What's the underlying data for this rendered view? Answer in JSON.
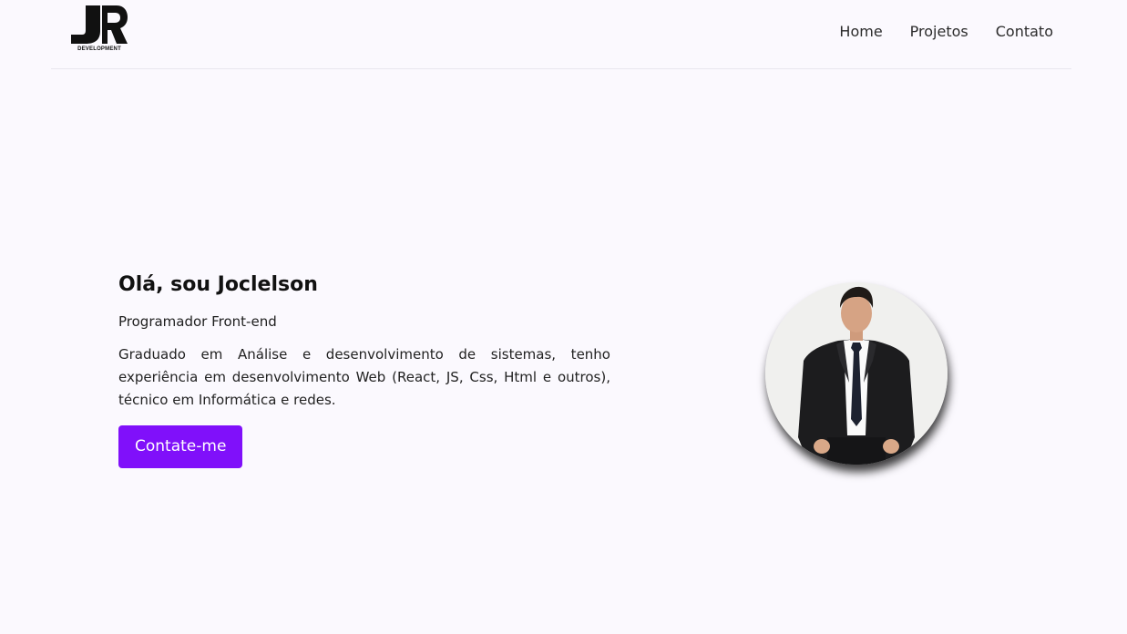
{
  "header": {
    "logo": {
      "mark": "JR",
      "caption": "DEVELOPMENT"
    },
    "nav": [
      {
        "label": "Home"
      },
      {
        "label": "Projetos"
      },
      {
        "label": "Contato"
      }
    ]
  },
  "hero": {
    "title": "Olá, sou Joclelson",
    "role": "Programador Front-end",
    "description": "Graduado em Análise e desenvolvimento de sistemas, tenho experiência em desenvolvimento Web (React, JS, Css, Html e outros), técnico em Informática e redes.",
    "cta_label": "Contate-me"
  },
  "colors": {
    "background": "#fbf9fe",
    "accent": "#8010fa",
    "text": "#111111"
  }
}
